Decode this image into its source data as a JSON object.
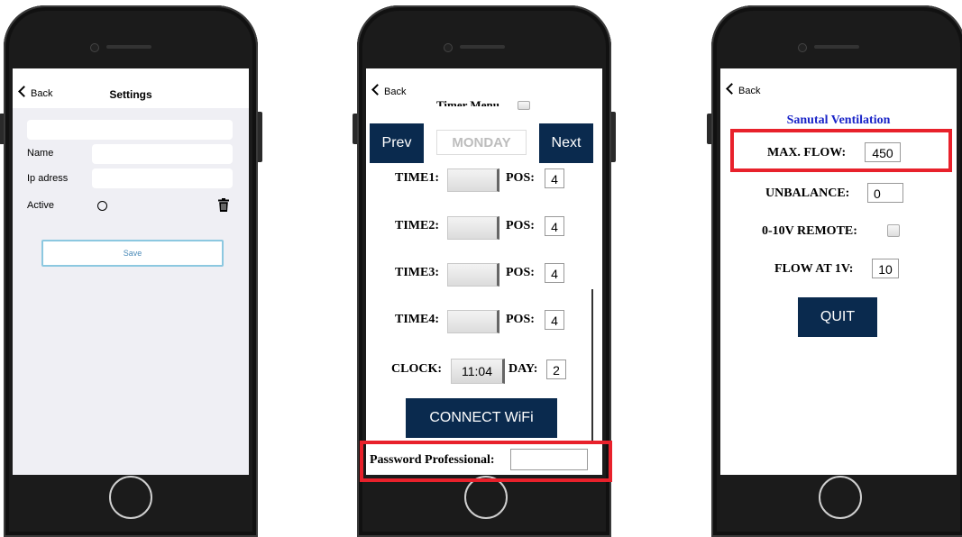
{
  "phone1": {
    "back_label": "Back",
    "title": "Settings",
    "name_label": "Name",
    "ip_label": "Ip adress",
    "active_label": "Active",
    "save_label": "Save"
  },
  "phone2": {
    "back_label": "Back",
    "timer_menu_label": "Timer Menu",
    "prev_label": "Prev",
    "day_display": "MONDAY",
    "next_label": "Next",
    "rows": [
      {
        "label": "TIME1:",
        "pos_label": "POS:",
        "pos_value": "4"
      },
      {
        "label": "TIME2:",
        "pos_label": "POS:",
        "pos_value": "4"
      },
      {
        "label": "TIME3:",
        "pos_label": "POS:",
        "pos_value": "4"
      },
      {
        "label": "TIME4:",
        "pos_label": "POS:",
        "pos_value": "4"
      }
    ],
    "clock_label": "CLOCK:",
    "clock_value": "11:04",
    "day_label": "DAY:",
    "day_value": "2",
    "connect_label": "CONNECT WiFi",
    "password_label": "Password Professional:"
  },
  "phone3": {
    "back_label": "Back",
    "title": "Sanutal Ventilation",
    "max_flow_label": "MAX. FLOW:",
    "max_flow_value": "450",
    "unbalance_label": "UNBALANCE:",
    "unbalance_value": "0",
    "remote_label": "0-10V REMOTE:",
    "flow_at_label": "FLOW AT 1V:",
    "flow_at_value": "10",
    "quit_label": "QUIT"
  },
  "colors": {
    "button_navy": "#0a2a4e",
    "highlight_red": "#e8212b",
    "title_blue": "#1a24c8",
    "save_border": "#8cc8e0"
  }
}
